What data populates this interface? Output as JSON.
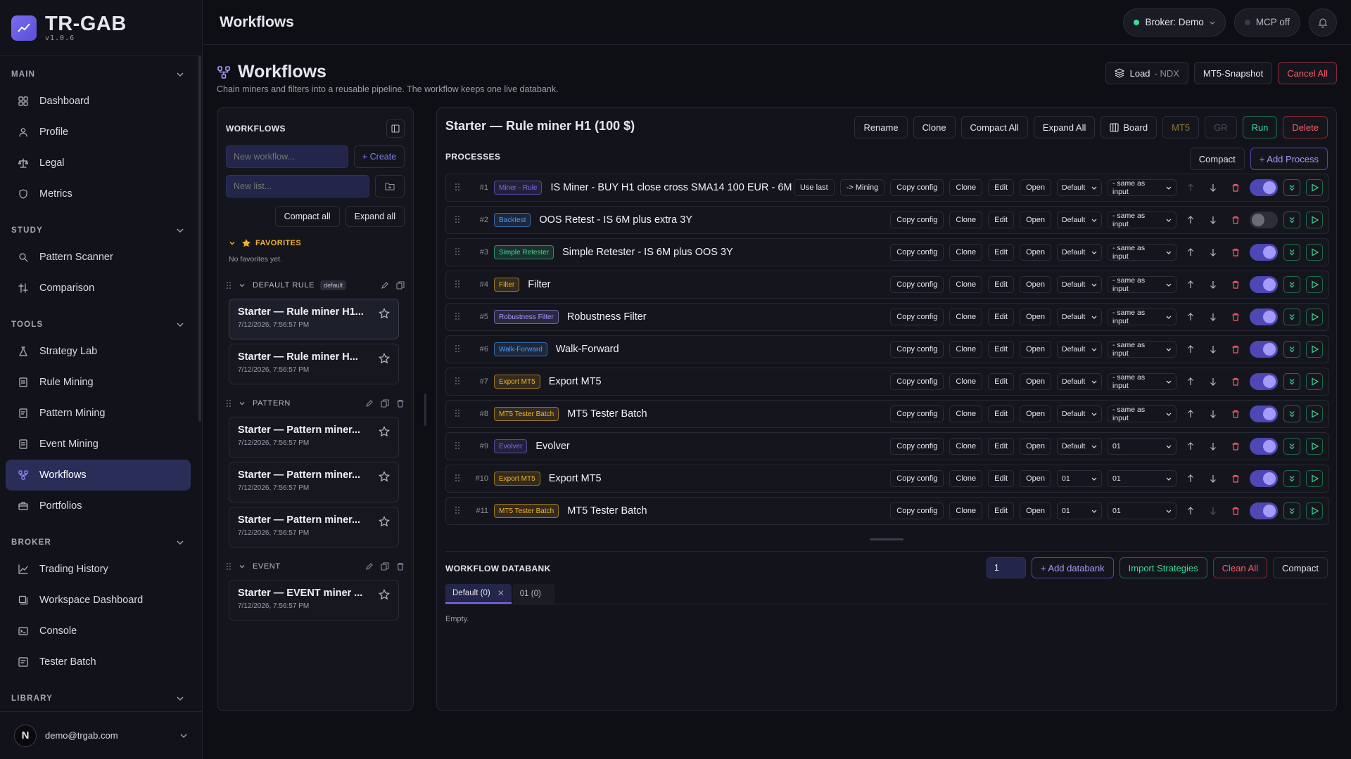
{
  "app": {
    "name": "TR-GAB",
    "version": "v1.0.6"
  },
  "sidebar": {
    "sections": [
      {
        "title": "MAIN",
        "items": [
          {
            "label": "Dashboard",
            "icon": "grid-icon"
          },
          {
            "label": "Profile",
            "icon": "user-icon"
          },
          {
            "label": "Legal",
            "icon": "scale-icon"
          },
          {
            "label": "Metrics",
            "icon": "shield-icon"
          }
        ]
      },
      {
        "title": "STUDY",
        "items": [
          {
            "label": "Pattern Scanner",
            "icon": "search-icon"
          },
          {
            "label": "Comparison",
            "icon": "compare-icon"
          }
        ]
      },
      {
        "title": "TOOLS",
        "items": [
          {
            "label": "Strategy Lab",
            "icon": "flask-icon"
          },
          {
            "label": "Rule Mining",
            "icon": "rule-icon"
          },
          {
            "label": "Pattern Mining",
            "icon": "pattern-icon"
          },
          {
            "label": "Event Mining",
            "icon": "event-icon"
          },
          {
            "label": "Workflows",
            "icon": "workflow-icon",
            "active": true
          },
          {
            "label": "Portfolios",
            "icon": "briefcase-icon"
          }
        ]
      },
      {
        "title": "BROKER",
        "items": [
          {
            "label": "Trading History",
            "icon": "chart-line-icon"
          },
          {
            "label": "Workspace Dashboard",
            "icon": "layers-icon"
          },
          {
            "label": "Console",
            "icon": "terminal-icon"
          },
          {
            "label": "Tester Batch",
            "icon": "batch-icon"
          }
        ]
      },
      {
        "title": "LIBRARY",
        "items": []
      }
    ],
    "user": {
      "initial": "N",
      "email": "demo@trgab.com"
    }
  },
  "topbar": {
    "title": "Workflows",
    "broker": "Broker: Demo",
    "mcp": "MCP off"
  },
  "page": {
    "title": "Workflows",
    "subtitle": "Chain miners and filters into a reusable pipeline. The workflow keeps one live databank.",
    "actions": {
      "load": "Load",
      "load_suffix": "- NDX",
      "snapshot": "MT5-Snapshot",
      "cancel_all": "Cancel All"
    }
  },
  "workflows_panel": {
    "title": "WORKFLOWS",
    "new_workflow_placeholder": "New workflow...",
    "create": "+ Create",
    "new_list_placeholder": "New list...",
    "compact_all": "Compact all",
    "expand_all": "Expand all",
    "favorites_title": "FAVORITES",
    "no_favorites": "No favorites yet.",
    "groups": [
      {
        "name": "DEFAULT RULE",
        "tag": "default",
        "cards": [
          {
            "title": "Starter — Rule miner H1...",
            "date": "7/12/2026, 7:56:57 PM",
            "active": true
          },
          {
            "title": "Starter — Rule miner H...",
            "date": "7/12/2026, 7:56:57 PM"
          }
        ]
      },
      {
        "name": "PATTERN",
        "tag": "",
        "cards": [
          {
            "title": "Starter — Pattern miner...",
            "date": "7/12/2026, 7:56:57 PM"
          },
          {
            "title": "Starter — Pattern miner...",
            "date": "7/12/2026, 7:56:57 PM"
          },
          {
            "title": "Starter — Pattern miner...",
            "date": "7/12/2026, 7:56:57 PM"
          }
        ]
      },
      {
        "name": "EVENT",
        "tag": "",
        "cards": [
          {
            "title": "Starter — EVENT miner ...",
            "date": "7/12/2026, 7:56:57 PM"
          }
        ]
      }
    ]
  },
  "main": {
    "title": "Starter — Rule miner H1 (100 $)",
    "actions": {
      "rename": "Rename",
      "clone": "Clone",
      "compact_all": "Compact All",
      "expand_all": "Expand All",
      "board": "Board",
      "mt5": "MT5",
      "gr": "GR",
      "run": "Run",
      "delete": "Delete"
    },
    "processes_title": "PROCESSES",
    "compact": "Compact",
    "add_process": "+ Add Process",
    "row_labels": {
      "use_last": "Use last",
      "mining": "-> Mining",
      "copy_config": "Copy config",
      "clone": "Clone",
      "edit": "Edit",
      "open": "Open"
    },
    "processes": [
      {
        "num": "#1",
        "badge": "Miner - Rule",
        "badge_color": "#7b6cf0",
        "title": "IS Miner - BUY H1 close cross SMA14 100 EUR - 6M",
        "sel1": "Default",
        "sel2": "- same as input",
        "enabled": true,
        "extra": true
      },
      {
        "num": "#2",
        "badge": "Backtest",
        "badge_color": "#4a9eff",
        "title": "OOS Retest - IS 6M plus extra 3Y",
        "sel1": "Default",
        "sel2": "- same as input",
        "enabled": false
      },
      {
        "num": "#3",
        "badge": "Simple Retester",
        "badge_color": "#3ddc97",
        "title": "Simple Retester - IS 6M plus OOS 3Y",
        "sel1": "Default",
        "sel2": "- same as input",
        "enabled": true
      },
      {
        "num": "#4",
        "badge": "Filter",
        "badge_color": "#f0b429",
        "title": "Filter",
        "sel1": "Default",
        "sel2": "- same as input",
        "enabled": true
      },
      {
        "num": "#5",
        "badge": "Robustness Filter",
        "badge_color": "#a49bff",
        "title": "Robustness Filter",
        "sel1": "Default",
        "sel2": "- same as input",
        "enabled": true
      },
      {
        "num": "#6",
        "badge": "Walk-Forward",
        "badge_color": "#4a9eff",
        "title": "Walk-Forward",
        "sel1": "Default",
        "sel2": "- same as input",
        "enabled": true
      },
      {
        "num": "#7",
        "badge": "Export MT5",
        "badge_color": "#f0b429",
        "title": "Export MT5",
        "sel1": "Default",
        "sel2": "- same as input",
        "enabled": true
      },
      {
        "num": "#8",
        "badge": "MT5 Tester Batch",
        "badge_color": "#f0b429",
        "title": "MT5 Tester Batch",
        "sel1": "Default",
        "sel2": "- same as input",
        "enabled": true
      },
      {
        "num": "#9",
        "badge": "Evolver",
        "badge_color": "#7b6cf0",
        "title": "Evolver",
        "sel1": "Default",
        "sel2": "01",
        "enabled": true
      },
      {
        "num": "#10",
        "badge": "Export MT5",
        "badge_color": "#f0b429",
        "title": "Export MT5",
        "sel1": "01",
        "sel2": "01",
        "enabled": true
      },
      {
        "num": "#11",
        "badge": "MT5 Tester Batch",
        "badge_color": "#f0b429",
        "title": "MT5 Tester Batch",
        "sel1": "01",
        "sel2": "01",
        "enabled": true
      }
    ],
    "databank": {
      "title": "WORKFLOW DATABANK",
      "input_value": "1",
      "add": "+ Add databank",
      "import": "Import Strategies",
      "clean": "Clean All",
      "compact": "Compact",
      "tabs": [
        {
          "label": "Default (0)",
          "active": true
        },
        {
          "label": "01 (0)"
        }
      ],
      "empty": "Empty."
    }
  }
}
